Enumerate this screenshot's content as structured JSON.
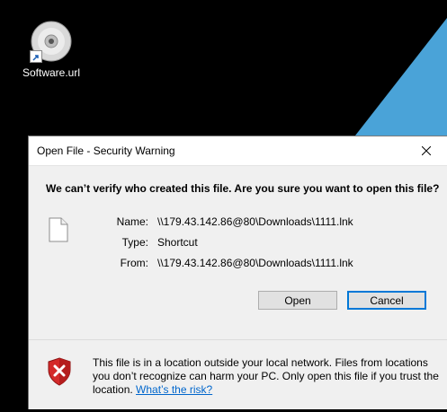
{
  "desktop": {
    "icon_label": "Software.url"
  },
  "dialog": {
    "title": "Open File - Security Warning",
    "question": "We can’t verify who created this file. Are you sure you want to open this file?",
    "fields": {
      "name_label": "Name:",
      "name_value": "\\\\179.43.142.86@80\\Downloads\\1111.lnk",
      "type_label": "Type:",
      "type_value": "Shortcut",
      "from_label": "From:",
      "from_value": "\\\\179.43.142.86@80\\Downloads\\1111.lnk"
    },
    "buttons": {
      "open": "Open",
      "cancel": "Cancel"
    },
    "warning": {
      "text": "This file is in a location outside your local network. Files from locations you don’t recognize can harm your PC. Only open this file if you trust the location. ",
      "link": "What’s the risk?"
    }
  },
  "colors": {
    "accent": "#0078d7",
    "wallpaper_beam": "#4aa3d8",
    "link": "#0066cc",
    "shield": "#d42a2a"
  }
}
